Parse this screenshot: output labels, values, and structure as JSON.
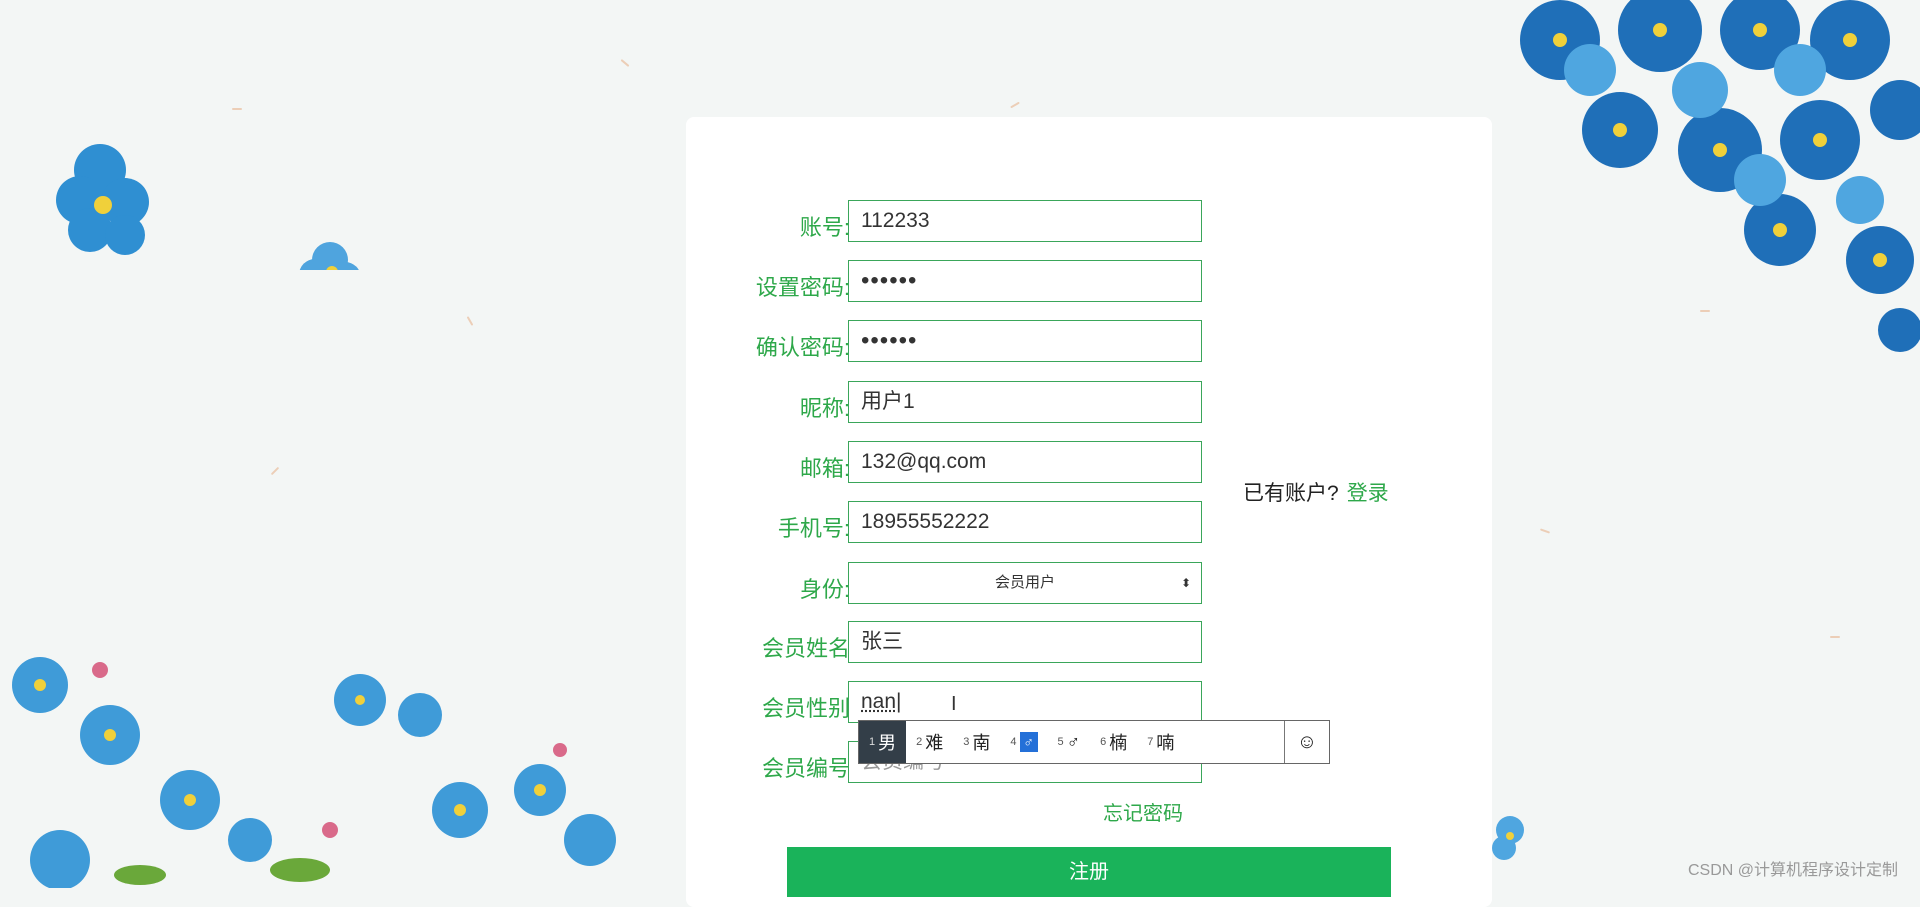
{
  "form": {
    "rows": [
      {
        "label": "账号:",
        "value": "112233"
      },
      {
        "label": "设置密码:",
        "value": "••••••"
      },
      {
        "label": "确认密码:",
        "value": "••••••"
      },
      {
        "label": "昵称:",
        "value": "用户1"
      },
      {
        "label": "邮箱:",
        "value": "132@qq.com"
      },
      {
        "label": "手机号:",
        "value": "18955552222"
      },
      {
        "label": "身份:",
        "value": "会员用户"
      },
      {
        "label": "会员姓名",
        "value": "张三"
      },
      {
        "label": "会员性别",
        "value": "nan"
      },
      {
        "label": "会员编号",
        "placeholder": "会员编号"
      }
    ],
    "has_account_text": "已有账户?",
    "login_link": "登录",
    "forgot_password": "忘记密码",
    "submit_label": "注册"
  },
  "ime": {
    "candidates": [
      {
        "index": "1",
        "text": "男"
      },
      {
        "index": "2",
        "text": "难"
      },
      {
        "index": "3",
        "text": "南"
      },
      {
        "index": "4",
        "text": "🚹"
      },
      {
        "index": "5",
        "text": "♂"
      },
      {
        "index": "6",
        "text": "楠"
      },
      {
        "index": "7",
        "text": "喃"
      }
    ],
    "emoji_icon": "smile-icon"
  },
  "watermark": "CSDN @计算机程序设计定制",
  "colors": {
    "accent": "#2ea84a",
    "button": "#1ab35a",
    "ime_active": "#333e48"
  }
}
